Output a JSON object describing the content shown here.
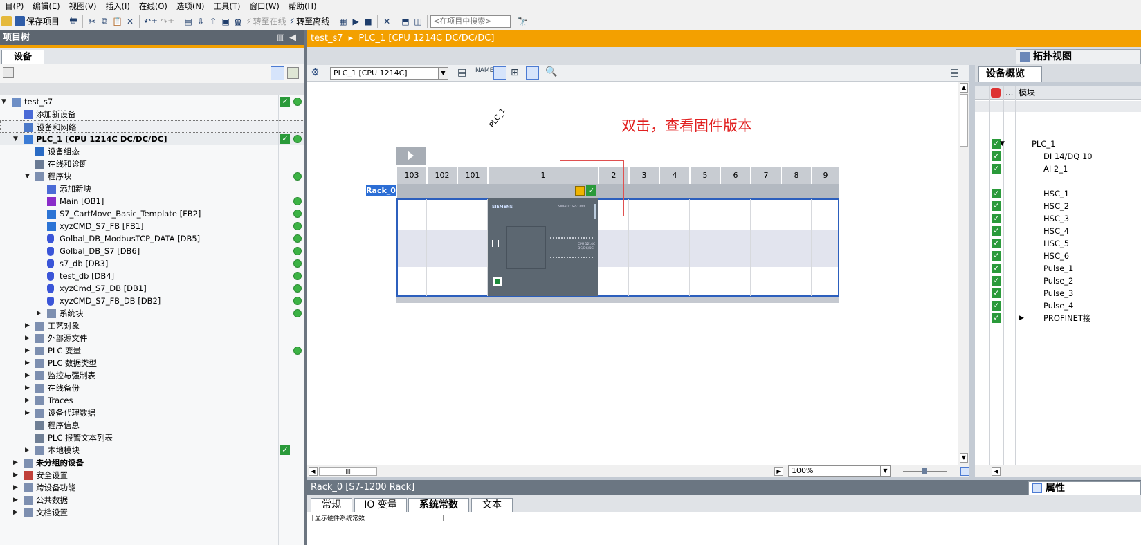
{
  "menu": [
    "目(P)",
    "编辑(E)",
    "视图(V)",
    "插入(I)",
    "在线(O)",
    "选项(N)",
    "工具(T)",
    "窗口(W)",
    "帮助(H)"
  ],
  "toolbar": {
    "save_project": "保存项目",
    "go_online": "转至在线",
    "go_offline": "转至离线",
    "search_placeholder": "<在项目中搜索>"
  },
  "tree": {
    "title": "项目树",
    "tab": "设备",
    "items": [
      {
        "label": "test_s7",
        "indent": 0,
        "arrow": "▼",
        "icon": "project",
        "check": true,
        "dot": true,
        "bold": false
      },
      {
        "label": "添加新设备",
        "indent": 1,
        "arrow": "",
        "icon": "add",
        "check": false,
        "dot": false,
        "bold": false
      },
      {
        "label": "设备和网络",
        "indent": 1,
        "arrow": "",
        "icon": "network",
        "check": false,
        "dot": false,
        "bold": false
      },
      {
        "label": "PLC_1 [CPU 1214C DC/DC/DC]",
        "indent": 1,
        "arrow": "▼",
        "icon": "plc",
        "check": true,
        "dot": true,
        "bold": true
      },
      {
        "label": "设备组态",
        "indent": 2,
        "arrow": "",
        "icon": "config",
        "check": false,
        "dot": false,
        "bold": false
      },
      {
        "label": "在线和诊断",
        "indent": 2,
        "arrow": "",
        "icon": "diag",
        "check": false,
        "dot": false,
        "bold": false
      },
      {
        "label": "程序块",
        "indent": 2,
        "arrow": "▼",
        "icon": "folder",
        "check": false,
        "dot": true,
        "bold": false
      },
      {
        "label": "添加新块",
        "indent": 3,
        "arrow": "",
        "icon": "add",
        "check": false,
        "dot": false,
        "bold": false
      },
      {
        "label": "Main [OB1]",
        "indent": 3,
        "arrow": "",
        "icon": "ob",
        "check": false,
        "dot": true,
        "bold": false
      },
      {
        "label": "S7_CartMove_Basic_Template [FB2]",
        "indent": 3,
        "arrow": "",
        "icon": "fb",
        "check": false,
        "dot": true,
        "bold": false
      },
      {
        "label": "xyzCMD_S7_FB [FB1]",
        "indent": 3,
        "arrow": "",
        "icon": "fb",
        "check": false,
        "dot": true,
        "bold": false
      },
      {
        "label": "Golbal_DB_ModbusTCP_DATA [DB5]",
        "indent": 3,
        "arrow": "",
        "icon": "db",
        "check": false,
        "dot": true,
        "bold": false
      },
      {
        "label": "Golbal_DB_S7 [DB6]",
        "indent": 3,
        "arrow": "",
        "icon": "db",
        "check": false,
        "dot": true,
        "bold": false
      },
      {
        "label": "s7_db [DB3]",
        "indent": 3,
        "arrow": "",
        "icon": "db",
        "check": false,
        "dot": true,
        "bold": false
      },
      {
        "label": "test_db [DB4]",
        "indent": 3,
        "arrow": "",
        "icon": "db",
        "check": false,
        "dot": true,
        "bold": false
      },
      {
        "label": "xyzCmd_S7_DB [DB1]",
        "indent": 3,
        "arrow": "",
        "icon": "db",
        "check": false,
        "dot": true,
        "bold": false
      },
      {
        "label": "xyzCMD_S7_FB_DB [DB2]",
        "indent": 3,
        "arrow": "",
        "icon": "db",
        "check": false,
        "dot": true,
        "bold": false
      },
      {
        "label": "系统块",
        "indent": 3,
        "arrow": "▶",
        "icon": "folder",
        "check": false,
        "dot": true,
        "bold": false
      },
      {
        "label": "工艺对象",
        "indent": 2,
        "arrow": "▶",
        "icon": "folder",
        "check": false,
        "dot": false,
        "bold": false
      },
      {
        "label": "外部源文件",
        "indent": 2,
        "arrow": "▶",
        "icon": "folder",
        "check": false,
        "dot": false,
        "bold": false
      },
      {
        "label": "PLC 变量",
        "indent": 2,
        "arrow": "▶",
        "icon": "folder",
        "check": false,
        "dot": true,
        "bold": false
      },
      {
        "label": "PLC 数据类型",
        "indent": 2,
        "arrow": "▶",
        "icon": "folder",
        "check": false,
        "dot": false,
        "bold": false
      },
      {
        "label": "监控与强制表",
        "indent": 2,
        "arrow": "▶",
        "icon": "folder",
        "check": false,
        "dot": false,
        "bold": false
      },
      {
        "label": "在线备份",
        "indent": 2,
        "arrow": "▶",
        "icon": "folder",
        "check": false,
        "dot": false,
        "bold": false
      },
      {
        "label": "Traces",
        "indent": 2,
        "arrow": "▶",
        "icon": "folder",
        "check": false,
        "dot": false,
        "bold": false
      },
      {
        "label": "设备代理数据",
        "indent": 2,
        "arrow": "▶",
        "icon": "folder",
        "check": false,
        "dot": false,
        "bold": false
      },
      {
        "label": "程序信息",
        "indent": 2,
        "arrow": "",
        "icon": "info",
        "check": false,
        "dot": false,
        "bold": false
      },
      {
        "label": "PLC 报警文本列表",
        "indent": 2,
        "arrow": "",
        "icon": "info",
        "check": false,
        "dot": false,
        "bold": false
      },
      {
        "label": "本地模块",
        "indent": 2,
        "arrow": "▶",
        "icon": "folder",
        "check": true,
        "dot": false,
        "bold": false
      },
      {
        "label": "未分组的设备",
        "indent": 1,
        "arrow": "▶",
        "icon": "folder",
        "check": false,
        "dot": false,
        "bold": true
      },
      {
        "label": "安全设置",
        "indent": 1,
        "arrow": "▶",
        "icon": "security",
        "check": false,
        "dot": false,
        "bold": false
      },
      {
        "label": "跨设备功能",
        "indent": 1,
        "arrow": "▶",
        "icon": "folder",
        "check": false,
        "dot": false,
        "bold": false
      },
      {
        "label": "公共数据",
        "indent": 1,
        "arrow": "▶",
        "icon": "folder",
        "check": false,
        "dot": false,
        "bold": false
      },
      {
        "label": "文档设置",
        "indent": 1,
        "arrow": "▶",
        "icon": "folder",
        "check": false,
        "dot": false,
        "bold": false
      }
    ]
  },
  "editor": {
    "breadcrumb_root": "test_s7",
    "breadcrumb_sep": "▸",
    "breadcrumb_leaf": "PLC_1 [CPU 1214C DC/DC/DC]",
    "topology_view": "拓扑视图",
    "device_select": "PLC_1 [CPU 1214C]",
    "plc_label": "PLC_1",
    "rack_label": "Rack_0",
    "slots": [
      "103",
      "102",
      "101",
      "1",
      "2",
      "3",
      "4",
      "5",
      "6",
      "7",
      "8",
      "9"
    ],
    "cpu_brand": "SIEMENS",
    "cpu_model": "SIMATIC S7-1200",
    "cpu_name": "CPU 1214C DC/DC/DC",
    "annotation": "双击，查看固件版本",
    "zoom": "100%"
  },
  "overview": {
    "tab": "设备概览",
    "col_module": "模块",
    "col_dots": "...",
    "rows": [
      {
        "label": "PLC_1",
        "indent": 1,
        "arrow": "▼",
        "check": true
      },
      {
        "label": "DI 14/DQ 10",
        "indent": 3,
        "arrow": "",
        "check": true
      },
      {
        "label": "AI 2_1",
        "indent": 3,
        "arrow": "",
        "check": true
      },
      {
        "label": "",
        "indent": 3,
        "arrow": "",
        "check": false
      },
      {
        "label": "HSC_1",
        "indent": 3,
        "arrow": "",
        "check": true
      },
      {
        "label": "HSC_2",
        "indent": 3,
        "arrow": "",
        "check": true
      },
      {
        "label": "HSC_3",
        "indent": 3,
        "arrow": "",
        "check": true
      },
      {
        "label": "HSC_4",
        "indent": 3,
        "arrow": "",
        "check": true
      },
      {
        "label": "HSC_5",
        "indent": 3,
        "arrow": "",
        "check": true
      },
      {
        "label": "HSC_6",
        "indent": 3,
        "arrow": "",
        "check": true
      },
      {
        "label": "Pulse_1",
        "indent": 3,
        "arrow": "",
        "check": true
      },
      {
        "label": "Pulse_2",
        "indent": 3,
        "arrow": "",
        "check": true
      },
      {
        "label": "Pulse_3",
        "indent": 3,
        "arrow": "",
        "check": true
      },
      {
        "label": "Pulse_4",
        "indent": 3,
        "arrow": "",
        "check": true
      },
      {
        "label": "PROFINET接",
        "indent": 2,
        "arrow": "▶",
        "check": true
      }
    ]
  },
  "bottom": {
    "title": "Rack_0 [S7-1200 Rack]",
    "properties": "属性",
    "tabs": [
      "常规",
      "IO 变量",
      "系统常数",
      "文本"
    ],
    "active_tab": "系统常数",
    "content_hint": "显示硬件系统常数"
  },
  "colors": {
    "accent_orange": "#f3a000",
    "ok_green": "#2a9a3a",
    "rack_blue": "#2c5fbd",
    "annotation_red": "#e12020"
  }
}
